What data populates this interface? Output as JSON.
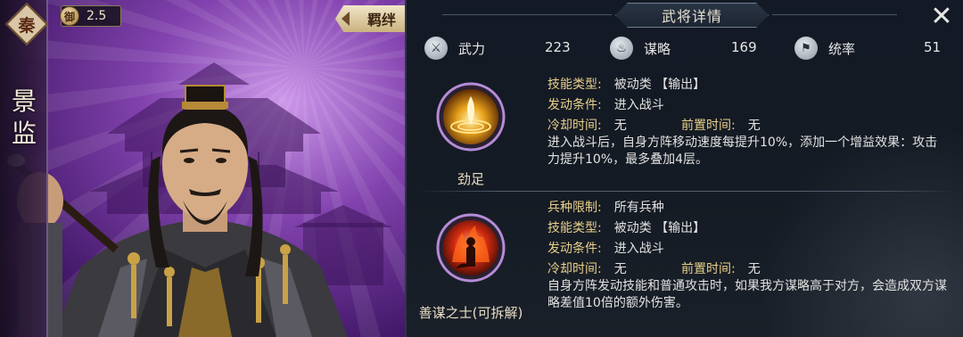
{
  "hero": {
    "faction": "秦",
    "name": "景监",
    "cost": "2.5",
    "cost_icon_text": "御",
    "bond_tab_label": "羁绊"
  },
  "panel": {
    "title": "武将详情",
    "close_label": "✕"
  },
  "stats": [
    {
      "label": "武力",
      "value": "223",
      "icon": "crossed-swords-icon"
    },
    {
      "label": "谋略",
      "value": "169",
      "icon": "flame-spirit-icon"
    },
    {
      "label": "统率",
      "value": "51",
      "icon": "banner-icon"
    }
  ],
  "skills": [
    {
      "name": "劲足",
      "icon": "golden-flame-icon",
      "rows": [
        {
          "key": "技能类型:",
          "value": "被动类 【输出】"
        },
        {
          "key": "发动条件:",
          "value": "进入战斗"
        }
      ],
      "cooldown_key": "冷却时间:",
      "cooldown_value": "无",
      "precast_key": "前置时间:",
      "precast_value": "无",
      "description": "进入战斗后，自身方阵移动速度每提升10%，添加一个增益效果：攻击力提升10%，最多叠加4层。"
    },
    {
      "name": "善谋之士(可拆解)",
      "icon": "red-flame-warrior-icon",
      "rows": [
        {
          "key": "兵种限制:",
          "value": "所有兵种"
        },
        {
          "key": "技能类型:",
          "value": "被动类 【输出】"
        },
        {
          "key": "发动条件:",
          "value": "进入战斗"
        }
      ],
      "cooldown_key": "冷却时间:",
      "cooldown_value": "无",
      "precast_key": "前置时间:",
      "precast_value": "无",
      "description": "自身方阵发动技能和普通攻击时，如果我方谋略高于对方，会造成双方谋略差值10倍的额外伤害。"
    }
  ]
}
